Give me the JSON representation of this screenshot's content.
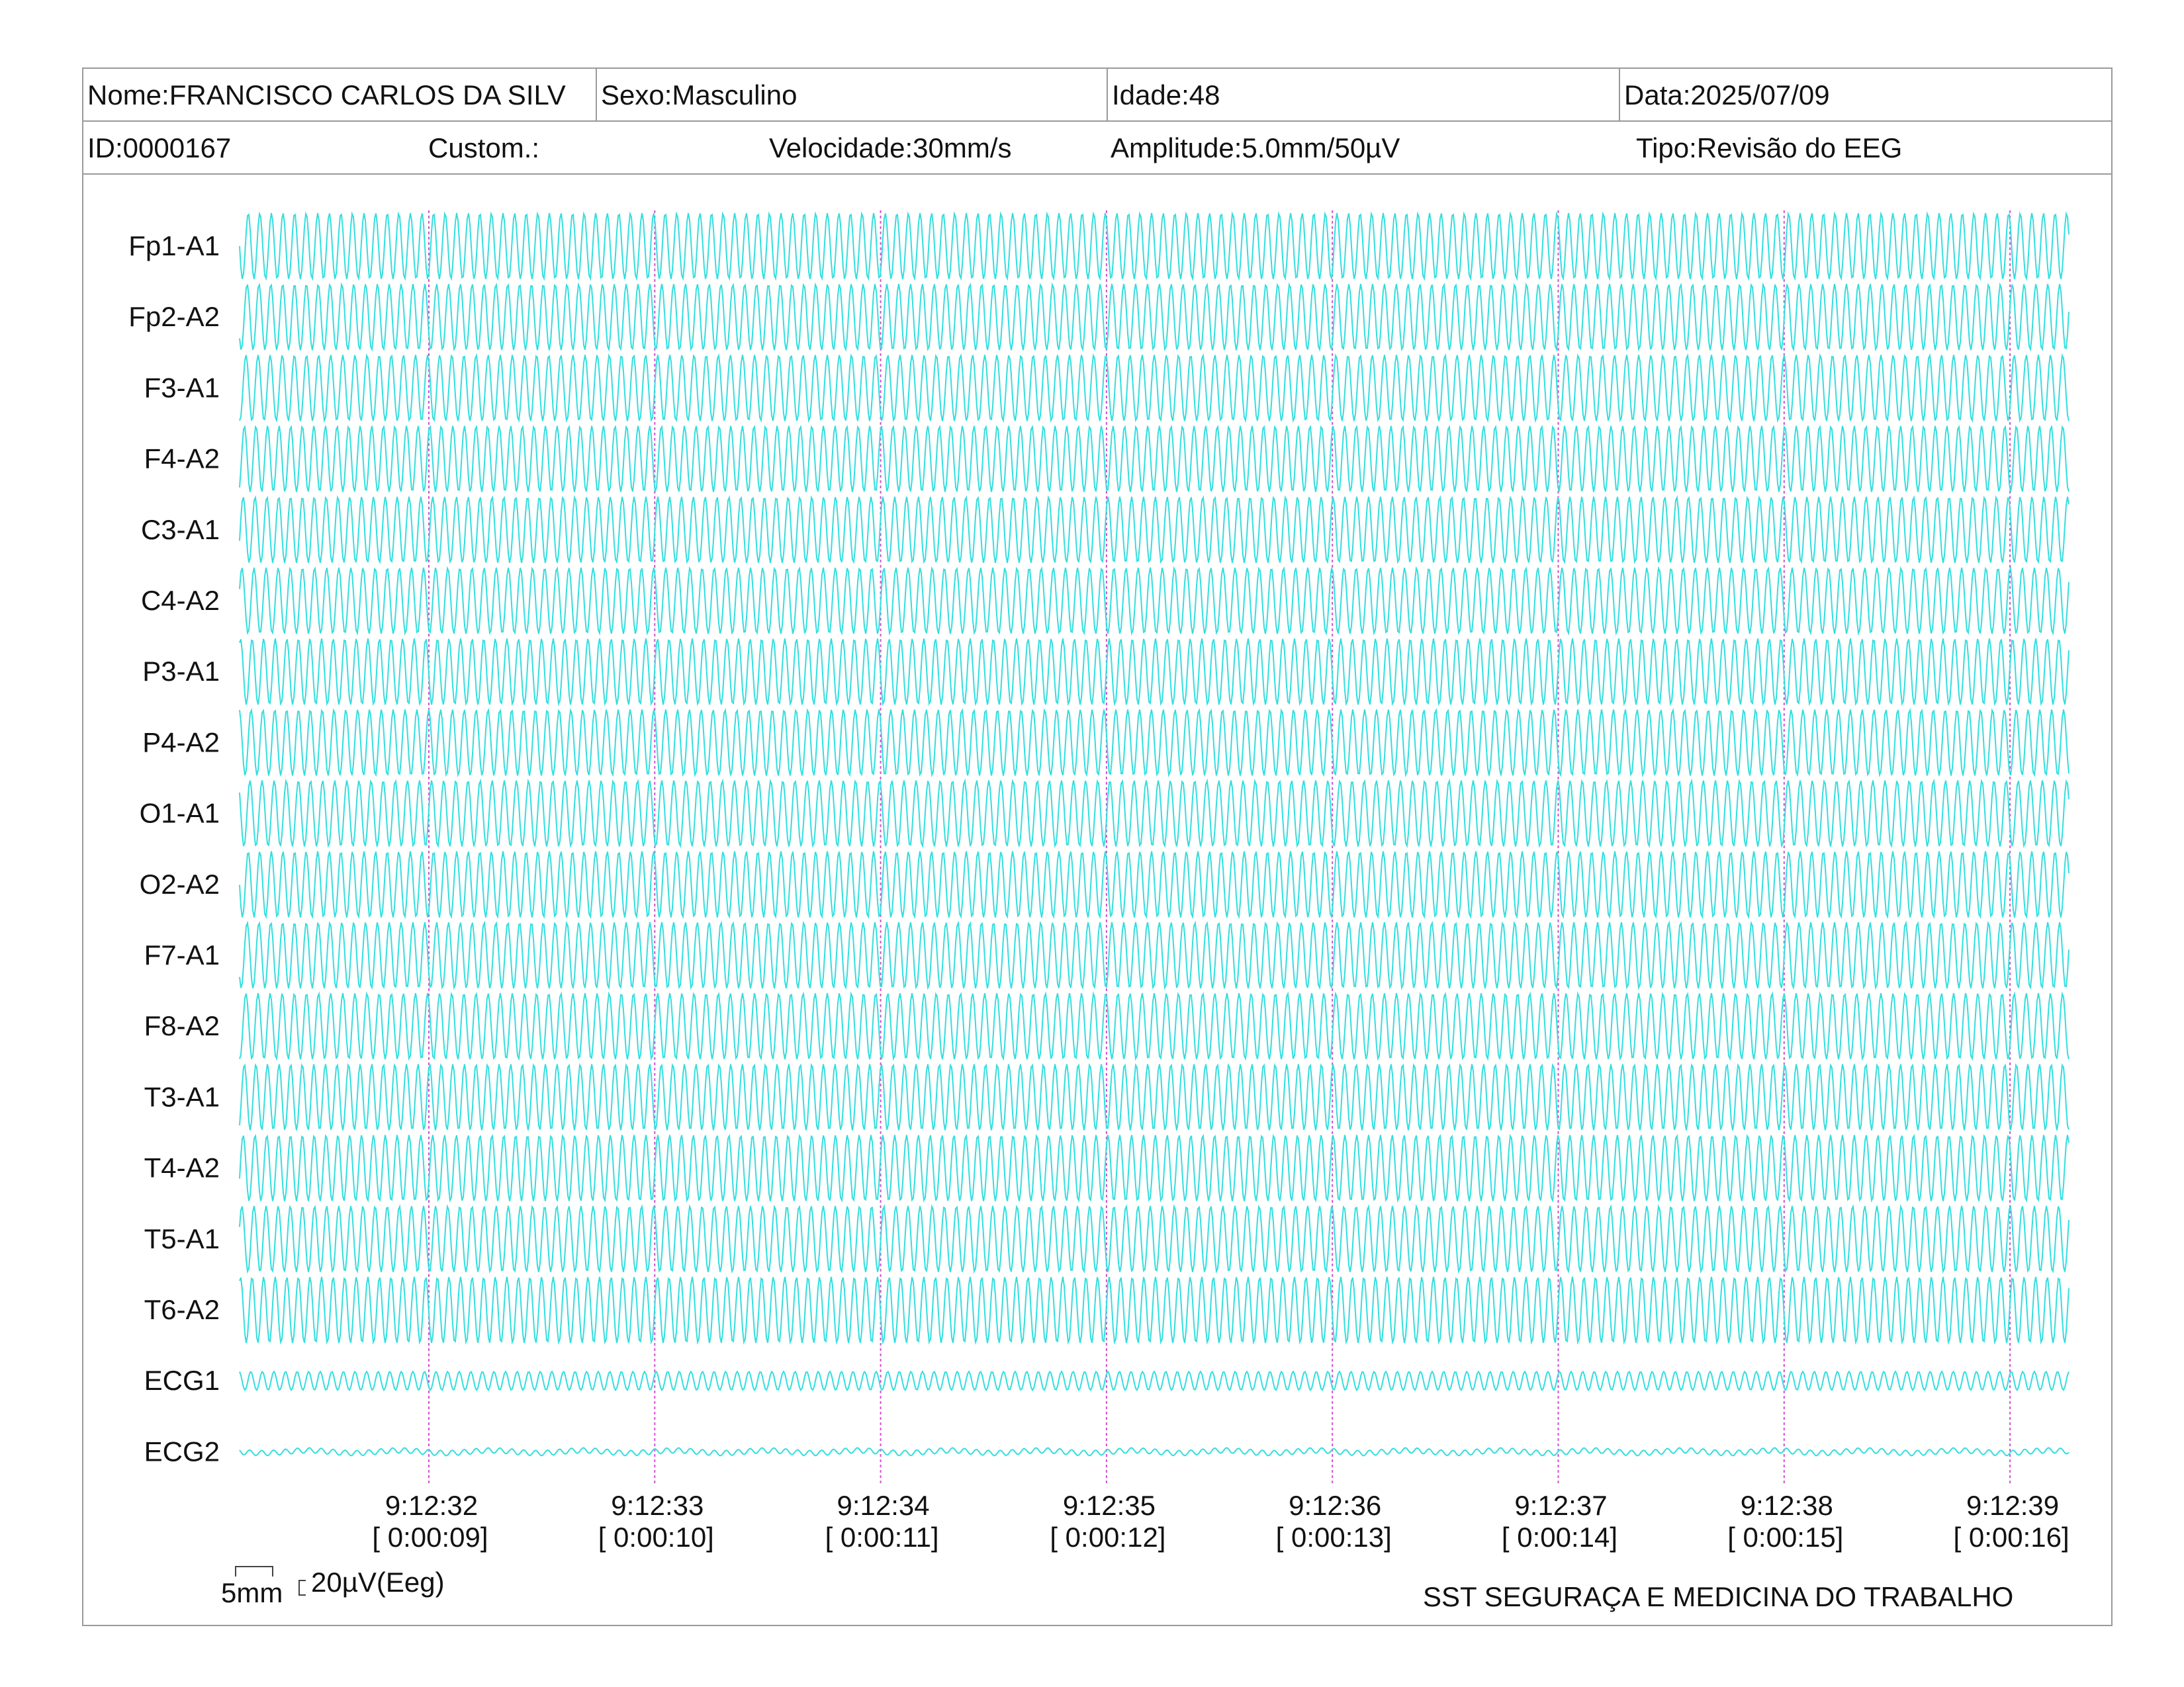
{
  "header": {
    "name": "Nome:FRANCISCO CARLOS DA SILV",
    "sex": "Sexo:Masculino",
    "age": "Idade:48",
    "date": "Data:2025/07/09",
    "id": "ID:0000167",
    "custom": "Custom.:",
    "speed": "Velocidade:30mm/s",
    "amplitude": "Amplitude:5.0mm/50µV",
    "type": "Tipo:Revisão do EEG"
  },
  "channels": [
    "Fp1-A1",
    "Fp2-A2",
    "F3-A1",
    "F4-A2",
    "C3-A1",
    "C4-A2",
    "P3-A1",
    "P4-A2",
    "O1-A1",
    "O2-A2",
    "F7-A1",
    "F8-A2",
    "T3-A1",
    "T4-A2",
    "T5-A1",
    "T6-A2",
    "ECG1",
    "ECG2"
  ],
  "time_marks": [
    {
      "clock": "9:12:32",
      "elapsed": "[ 0:00:09]"
    },
    {
      "clock": "9:12:33",
      "elapsed": "[ 0:00:10]"
    },
    {
      "clock": "9:12:34",
      "elapsed": "[ 0:00:11]"
    },
    {
      "clock": "9:12:35",
      "elapsed": "[ 0:00:12]"
    },
    {
      "clock": "9:12:36",
      "elapsed": "[ 0:00:13]"
    },
    {
      "clock": "9:12:37",
      "elapsed": "[ 0:00:14]"
    },
    {
      "clock": "9:12:38",
      "elapsed": "[ 0:00:15]"
    },
    {
      "clock": "9:12:39",
      "elapsed": "[ 0:00:16]"
    }
  ],
  "scale": {
    "time": "5mm",
    "amplitude": "20µV(Eeg)"
  },
  "footer": "SST SEGURAÇA E MEDICINA DO TRABALHO",
  "colors": {
    "trace": "#33dede",
    "marker": "#d24fd2",
    "border": "#9a9a9a"
  }
}
